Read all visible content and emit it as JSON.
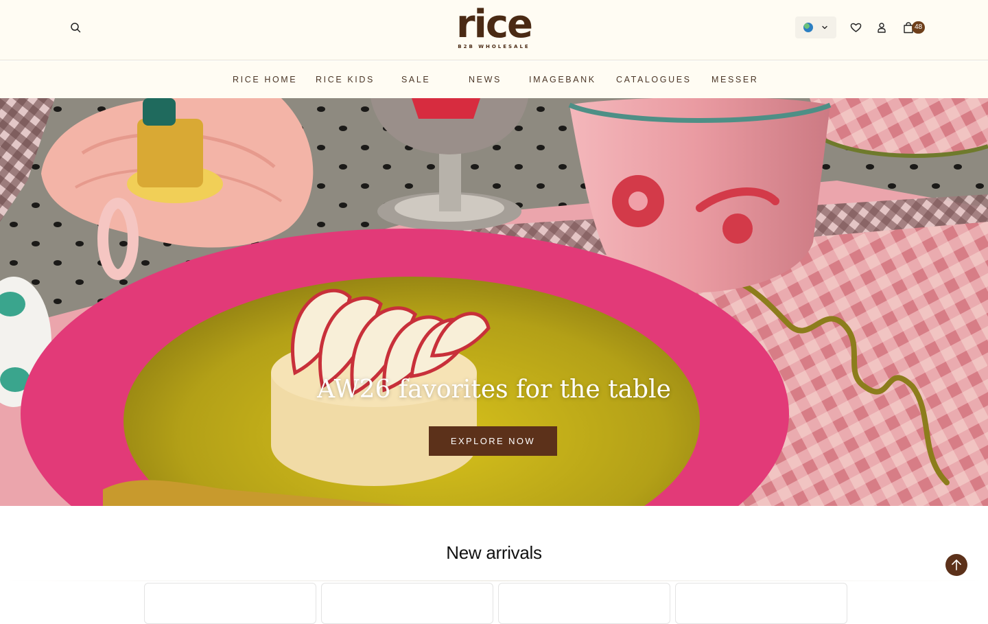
{
  "header": {
    "logo_text": "rice",
    "logo_subtitle": "B2B WHOLESALE",
    "search_icon": "search-icon",
    "language_icon": "globe-icon",
    "wishlist_icon": "heart-icon",
    "account_icon": "user-icon",
    "cart_icon": "shopping-bag-icon",
    "cart_count": "48"
  },
  "nav": {
    "items": [
      {
        "label": "RICE HOME"
      },
      {
        "label": "RICE KIDS"
      },
      {
        "label": "SALE"
      },
      {
        "label": "NEWS"
      },
      {
        "label": "IMAGEBANK"
      },
      {
        "label": "CATALOGUES"
      },
      {
        "label": "MESSER"
      }
    ]
  },
  "hero": {
    "title": "AW26 favorites for the table",
    "cta_label": "EXPLORE NOW"
  },
  "new_arrivals": {
    "title": "New arrivals"
  },
  "colors": {
    "brand_brown": "#5c311a",
    "header_bg": "#fffcf3",
    "logo_brown": "#4a2a14"
  }
}
